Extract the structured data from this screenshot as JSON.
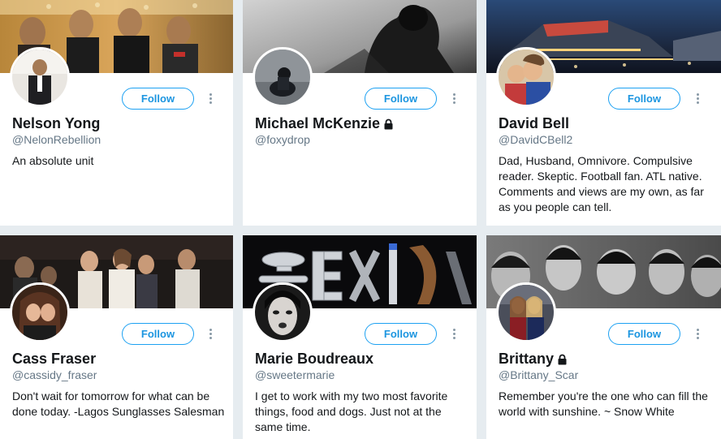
{
  "follow_label": "Follow",
  "colors": {
    "accent": "#1da1f2",
    "background": "#e6ecf0",
    "handle": "#657786"
  },
  "cards": [
    {
      "name": "Nelson Yong",
      "handle": "@NelonRebellion",
      "bio": "An absolute unit",
      "protected": false
    },
    {
      "name": "Michael McKenzie",
      "handle": "@foxydrop",
      "bio": "",
      "protected": true
    },
    {
      "name": "David Bell",
      "handle": "@DavidCBell2",
      "bio": "Dad, Husband, Omnivore. Compulsive reader. Skeptic. Football fan. ATL native. Comments and views are my own, as far as you people can tell.",
      "protected": false
    },
    {
      "name": "Cass Fraser",
      "handle": "@cassidy_fraser",
      "bio": "Don't wait for tomorrow for what can be done today. -Lagos Sunglasses Salesman",
      "protected": false
    },
    {
      "name": "Marie Boudreaux",
      "handle": "@sweetermarie",
      "bio": "I get to work with my two most favorite things, food and dogs. Just not at the same time.",
      "protected": false
    },
    {
      "name": "Brittany",
      "handle": "@Brittany_Scar",
      "bio": "Remember you're the one who can fill the world with sunshine. ~ Snow White",
      "protected": true
    }
  ]
}
